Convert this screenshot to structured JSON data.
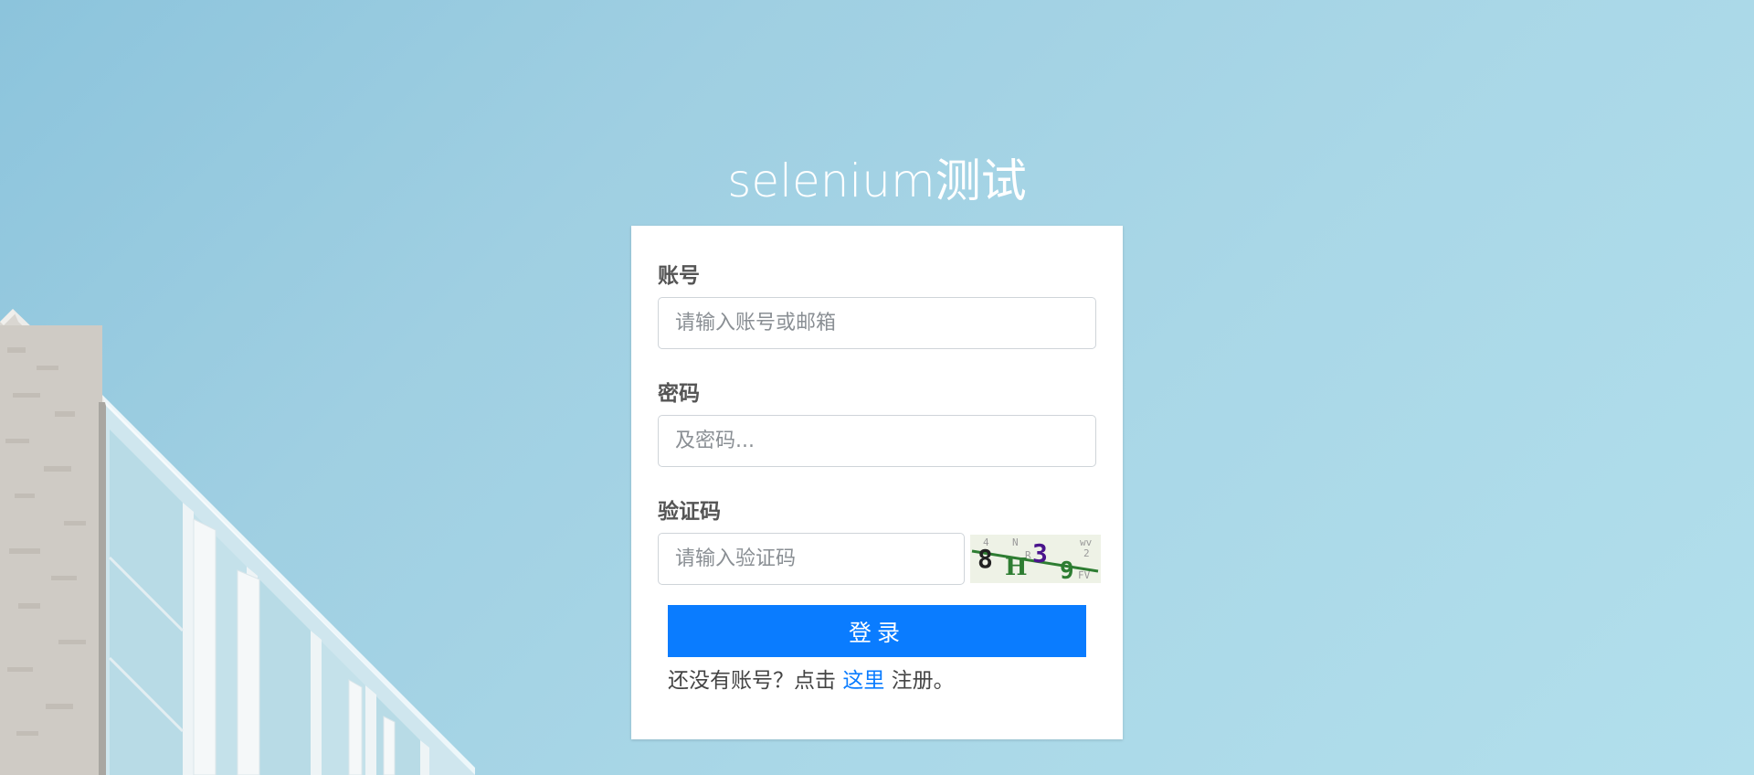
{
  "page": {
    "title": "selenium测试"
  },
  "form": {
    "account": {
      "label": "账号",
      "placeholder": "请输入账号或邮箱"
    },
    "password": {
      "label": "密码",
      "placeholder": "及密码..."
    },
    "captcha": {
      "label": "验证码",
      "placeholder": "请输入验证码",
      "image_text": "8H39"
    },
    "login_label": "登录",
    "register": {
      "prefix": "还没有账号？点击",
      "link": "这里",
      "suffix": "注册。"
    }
  },
  "colors": {
    "accent": "#0a7cff",
    "background": "#a4d3e6"
  }
}
